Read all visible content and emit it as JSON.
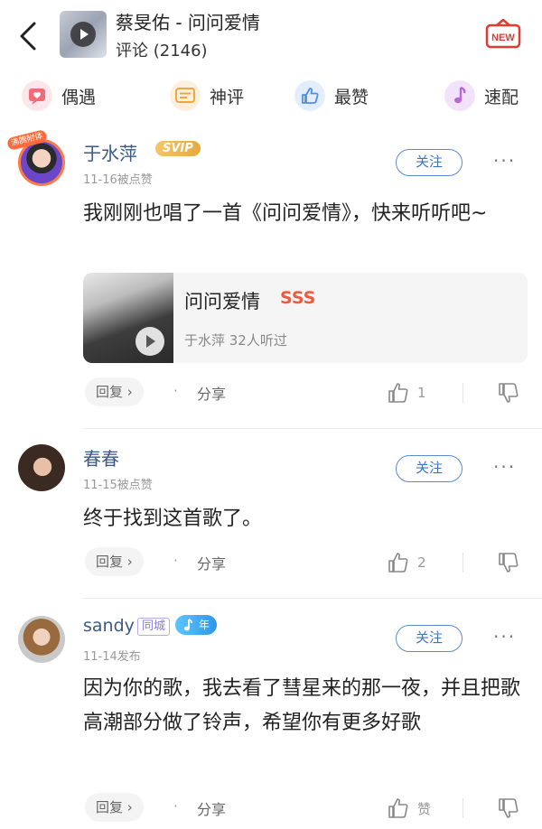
{
  "header": {
    "song_title": "蔡旻佑 - 问问爱情",
    "comment_count": "评论 (2146)",
    "new_badge": "NEW"
  },
  "tabs": [
    {
      "label": "偶遇",
      "icon": "heart-chat-icon",
      "color": "#f26b7a"
    },
    {
      "label": "神评",
      "icon": "comment-lines-icon",
      "color": "#f3a53f"
    },
    {
      "label": "最赞",
      "icon": "thumbs-up-icon",
      "color": "#4d8fe6"
    },
    {
      "label": "速配",
      "icon": "music-note-icon",
      "color": "#b56ad6"
    }
  ],
  "comments": [
    {
      "username": "于水萍",
      "badge": "SVIP",
      "avatar_tag": "沸腾附体",
      "time": "11-16被点赞",
      "follow": "关注",
      "more": "···",
      "text": "我刚刚也唱了一首《问问爱情》，快来听听吧~",
      "music": {
        "title": "问问爱情",
        "grade": "SSS",
        "meta": "于水萍  32人听过"
      },
      "reply": "回复 ›",
      "dot": "·",
      "share": "分享",
      "likes": "1"
    },
    {
      "username": "春春",
      "time": "11-15被点赞",
      "follow": "关注",
      "more": "···",
      "text": "终于找到这首歌了。",
      "reply": "回复 ›",
      "dot": "·",
      "share": "分享",
      "likes": "2"
    },
    {
      "username": "sandy",
      "tag_city": "同城",
      "tag_year": "年",
      "time": "11-14发布",
      "follow": "关注",
      "more": "···",
      "text": "因为你的歌，我去看了彗星来的那一夜，并且把歌高潮部分做了铃声，希望你有更多好歌",
      "reply": "回复 ›",
      "dot": "·",
      "share": "分享",
      "likes": "赞"
    }
  ]
}
